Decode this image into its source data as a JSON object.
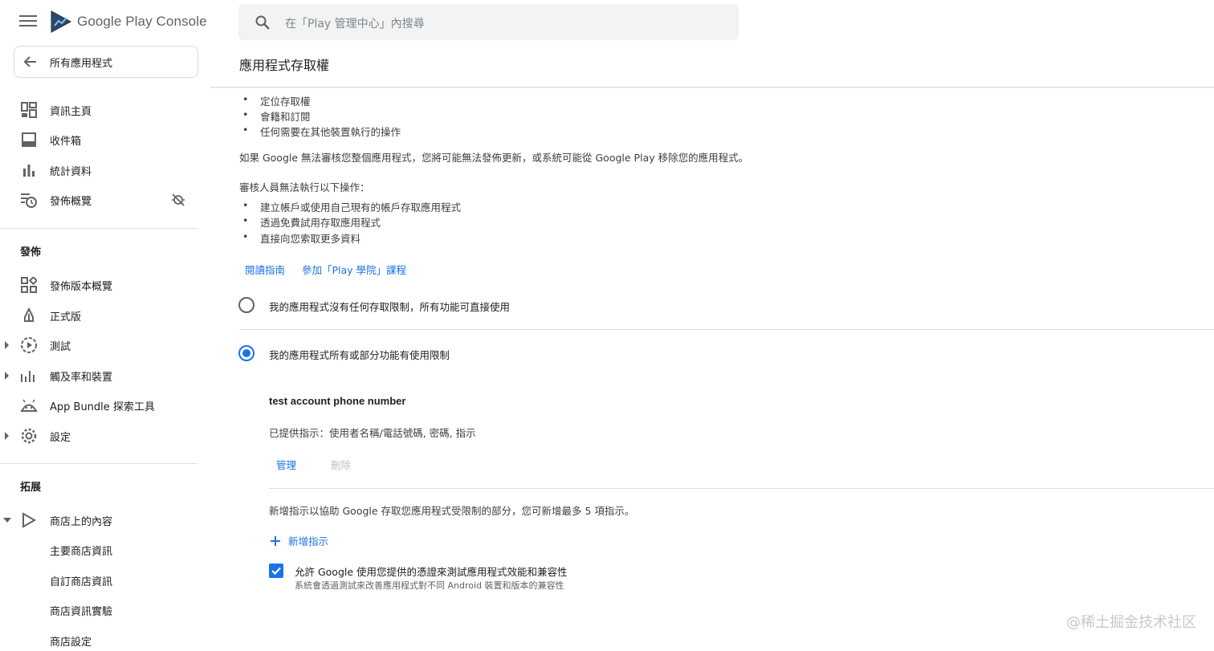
{
  "app": {
    "brand_google_play": "Google Play",
    "brand_console": "Console",
    "back_label": "所有應用程式"
  },
  "search": {
    "placeholder": "在「Play 管理中心」內搜尋"
  },
  "sidebar": {
    "items": [
      {
        "label": "資訊主頁",
        "icon": "dashboard-icon"
      },
      {
        "label": "收件箱",
        "icon": "inbox-icon"
      },
      {
        "label": "統計資料",
        "icon": "bar-chart-icon"
      },
      {
        "label": "發佈概覽",
        "icon": "publishing-overview-icon"
      }
    ],
    "section_release": "發佈",
    "release_items": [
      {
        "label": "發佈版本概覽",
        "icon": "release-overview-icon"
      },
      {
        "label": "正式版",
        "icon": "production-icon"
      },
      {
        "label": "測試",
        "icon": "testing-icon"
      },
      {
        "label": "觸及率和裝置",
        "icon": "reach-devices-icon"
      },
      {
        "label": "App Bundle 探索工具",
        "icon": "android-icon"
      },
      {
        "label": "設定",
        "icon": "gear-icon"
      }
    ],
    "section_grow": "拓展",
    "grow_items": [
      {
        "label": "商店上的內容",
        "icon": "play-icon"
      }
    ],
    "store_sub_items": [
      {
        "label": "主要商店資訊"
      },
      {
        "label": "自訂商店資訊"
      },
      {
        "label": "商店資訊實驗"
      },
      {
        "label": "商店設定"
      }
    ]
  },
  "page": {
    "title": "應用程式存取權",
    "bullets_top": [
      "定位存取權",
      "會籍和訂閱",
      "任何需要在其他裝置執行的操作"
    ],
    "warning": "如果 Google 無法審核您整個應用程式，您將可能無法發佈更新，或系統可能從 Google Play 移除您的應用程式。",
    "reviewer_heading": "審核人員無法執行以下操作：",
    "reviewer_bullets": [
      "建立帳戶或使用自己現有的帳戶存取應用程式",
      "透過免費試用存取應用程式",
      "直接向您索取更多資料"
    ],
    "link_guide": "閱讀指南",
    "link_academy": "參加「Play 學院」課程",
    "option_no_restriction": "我的應用程式沒有任何存取限制，所有功能可直接使用",
    "option_restricted": "我的應用程式所有或部分功能有使用限制",
    "instruction_name": "test account phone number",
    "instruction_provided": "已提供指示：使用者名稱/電話號碼, 密碼, 指示",
    "manage_label": "管理",
    "delete_label": "刪除",
    "add_note": "新增指示以協助 Google 存取您應用程式受限制的部分，您可新增最多 5 項指示。",
    "add_instruction_label": "新增指示",
    "allow_checkbox_label": "允許 Google 使用您提供的憑證來測試應用程式效能和兼容性",
    "allow_checkbox_sub": "系統會透過測試來改善應用程式對不同 Android 裝置和版本的兼容性",
    "allow_checked": true,
    "selected_option": "restricted"
  },
  "watermark": "@稀土掘金技术社区",
  "colors": {
    "accent": "#1a73e8",
    "text": "#202124",
    "muted": "#5f6368",
    "divider": "#dadce0"
  }
}
